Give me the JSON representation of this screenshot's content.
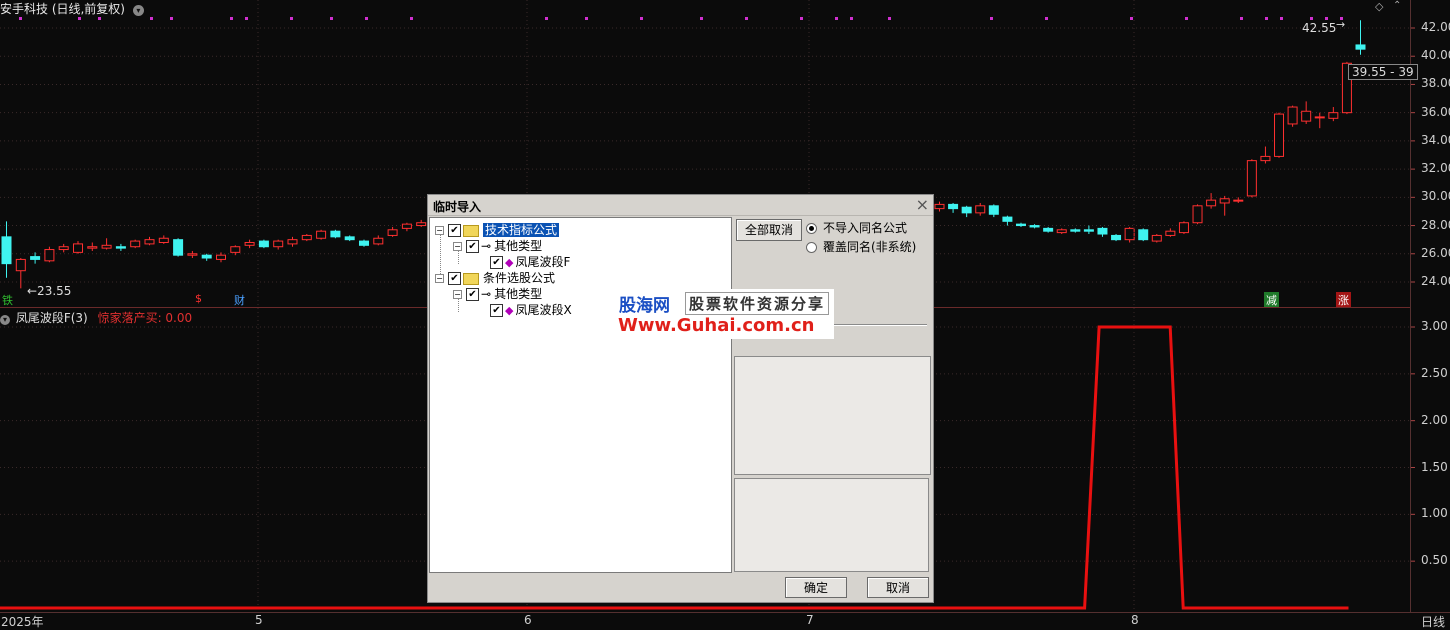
{
  "header": {
    "stock_title": "安手科技 (日线,前复权)",
    "indicator_title": "凤尾波段F(3)",
    "indicator_value": "惊家落产买: 0.00"
  },
  "colors": {
    "up": "#ff3030",
    "down": "#3ff3f0",
    "ma_dot": "#d030d0",
    "indicator_line": "#e81010",
    "grid": "#3a2a2a"
  },
  "price_axis": {
    "ticks": [
      "42.00",
      "40.00",
      "38.00",
      "36.00",
      "34.00",
      "32.00",
      "30.00",
      "28.00",
      "26.00",
      "24.00"
    ]
  },
  "indicator_axis": {
    "ticks": [
      "3.00",
      "2.50",
      "2.00",
      "1.50",
      "1.00",
      "0.50"
    ]
  },
  "time_axis": {
    "ticks": [
      "2025年",
      "5",
      "6",
      "7",
      "8"
    ],
    "period": "日线"
  },
  "price_labels": {
    "low": "←23.55",
    "high": "42.55",
    "range": "39.55 - 39"
  },
  "events": [
    {
      "text": "铁",
      "color": "#30c030"
    },
    {
      "text": "$",
      "color": "#ff3030"
    },
    {
      "text": "财",
      "color": "#4aa0ff"
    },
    {
      "text": "减",
      "color": "#2ecc40"
    },
    {
      "text": "涨",
      "color": "#ff3030"
    }
  ],
  "chart_data": [
    {
      "type": "candlestick",
      "title": "安手科技 (日线,前复权)",
      "ylim": [
        23,
        43
      ],
      "x": [
        "2025年",
        "5",
        "6",
        "7",
        "8"
      ],
      "candles": [
        {
          "o": 27.2,
          "c": 25.3,
          "h": 28.3,
          "l": 24.3
        },
        {
          "o": 24.8,
          "c": 25.6,
          "h": 25.7,
          "l": 23.55
        },
        {
          "o": 25.8,
          "c": 25.6,
          "h": 26.1,
          "l": 25.3
        },
        {
          "o": 25.5,
          "c": 26.3,
          "h": 26.5,
          "l": 25.4
        },
        {
          "o": 26.3,
          "c": 26.5,
          "h": 26.7,
          "l": 26.1
        },
        {
          "o": 26.1,
          "c": 26.7,
          "h": 26.9,
          "l": 26.0
        },
        {
          "o": 26.4,
          "c": 26.5,
          "h": 26.8,
          "l": 26.2
        },
        {
          "o": 26.4,
          "c": 26.6,
          "h": 27.1,
          "l": 26.3
        },
        {
          "o": 26.5,
          "c": 26.4,
          "h": 26.7,
          "l": 26.2
        },
        {
          "o": 26.5,
          "c": 26.9,
          "h": 27.0,
          "l": 26.4
        },
        {
          "o": 26.7,
          "c": 27.0,
          "h": 27.2,
          "l": 26.6
        },
        {
          "o": 26.8,
          "c": 27.1,
          "h": 27.3,
          "l": 26.7
        },
        {
          "o": 27.0,
          "c": 25.9,
          "h": 27.1,
          "l": 25.8
        },
        {
          "o": 25.9,
          "c": 26.0,
          "h": 26.2,
          "l": 25.7
        },
        {
          "o": 25.9,
          "c": 25.7,
          "h": 26.0,
          "l": 25.5
        },
        {
          "o": 25.6,
          "c": 25.9,
          "h": 26.1,
          "l": 25.4
        },
        {
          "o": 26.1,
          "c": 26.5,
          "h": 26.6,
          "l": 25.9
        },
        {
          "o": 26.6,
          "c": 26.8,
          "h": 27.0,
          "l": 26.4
        },
        {
          "o": 26.9,
          "c": 26.5,
          "h": 27.0,
          "l": 26.4
        },
        {
          "o": 26.5,
          "c": 26.9,
          "h": 27.0,
          "l": 26.3
        },
        {
          "o": 26.7,
          "c": 27.0,
          "h": 27.2,
          "l": 26.5
        },
        {
          "o": 27.0,
          "c": 27.3,
          "h": 27.4,
          "l": 26.9
        },
        {
          "o": 27.1,
          "c": 27.6,
          "h": 27.7,
          "l": 27.0
        },
        {
          "o": 27.6,
          "c": 27.2,
          "h": 27.7,
          "l": 27.1
        },
        {
          "o": 27.2,
          "c": 27.0,
          "h": 27.3,
          "l": 26.9
        },
        {
          "o": 26.9,
          "c": 26.6,
          "h": 27.0,
          "l": 26.5
        },
        {
          "o": 26.7,
          "c": 27.1,
          "h": 27.3,
          "l": 26.6
        },
        {
          "o": 27.3,
          "c": 27.7,
          "h": 27.9,
          "l": 27.2
        },
        {
          "o": 27.8,
          "c": 28.1,
          "h": 28.2,
          "l": 27.6
        },
        {
          "o": 28.0,
          "c": 28.2,
          "h": 28.4,
          "l": 27.9
        },
        {
          "o": 29.2,
          "c": 29.5,
          "h": 29.7,
          "l": 29.0
        },
        {
          "o": 29.5,
          "c": 29.2,
          "h": 29.6,
          "l": 28.9
        },
        {
          "o": 29.3,
          "c": 28.9,
          "h": 29.4,
          "l": 28.6
        },
        {
          "o": 28.9,
          "c": 29.4,
          "h": 29.6,
          "l": 28.7
        },
        {
          "o": 29.4,
          "c": 28.8,
          "h": 29.5,
          "l": 28.6
        },
        {
          "o": 28.6,
          "c": 28.3,
          "h": 28.7,
          "l": 28.0
        },
        {
          "o": 28.1,
          "c": 28.0,
          "h": 28.2,
          "l": 27.9
        },
        {
          "o": 28.0,
          "c": 27.9,
          "h": 28.1,
          "l": 27.8
        },
        {
          "o": 27.8,
          "c": 27.6,
          "h": 27.9,
          "l": 27.5
        },
        {
          "o": 27.5,
          "c": 27.7,
          "h": 27.8,
          "l": 27.4
        },
        {
          "o": 27.7,
          "c": 27.6,
          "h": 27.8,
          "l": 27.5
        },
        {
          "o": 27.7,
          "c": 27.6,
          "h": 28.0,
          "l": 27.4
        },
        {
          "o": 27.8,
          "c": 27.4,
          "h": 27.9,
          "l": 27.2
        },
        {
          "o": 27.3,
          "c": 27.0,
          "h": 27.4,
          "l": 26.9
        },
        {
          "o": 27.0,
          "c": 27.8,
          "h": 27.9,
          "l": 26.8
        },
        {
          "o": 27.7,
          "c": 27.0,
          "h": 27.8,
          "l": 26.9
        },
        {
          "o": 26.9,
          "c": 27.3,
          "h": 27.4,
          "l": 26.8
        },
        {
          "o": 27.3,
          "c": 27.6,
          "h": 27.8,
          "l": 27.2
        },
        {
          "o": 27.5,
          "c": 28.2,
          "h": 28.3,
          "l": 27.4
        },
        {
          "o": 28.2,
          "c": 29.4,
          "h": 29.5,
          "l": 28.1
        },
        {
          "o": 29.4,
          "c": 29.8,
          "h": 30.3,
          "l": 29.2
        },
        {
          "o": 29.6,
          "c": 29.9,
          "h": 30.1,
          "l": 28.7
        },
        {
          "o": 29.8,
          "c": 29.8,
          "h": 30.0,
          "l": 29.6
        },
        {
          "o": 30.1,
          "c": 32.6,
          "h": 32.7,
          "l": 30.0
        },
        {
          "o": 32.6,
          "c": 32.9,
          "h": 33.6,
          "l": 32.4
        },
        {
          "o": 32.9,
          "c": 35.9,
          "h": 36.0,
          "l": 32.8
        },
        {
          "o": 35.2,
          "c": 36.4,
          "h": 36.5,
          "l": 35.0
        },
        {
          "o": 35.4,
          "c": 36.1,
          "h": 36.8,
          "l": 35.2
        },
        {
          "o": 35.7,
          "c": 35.7,
          "h": 36.0,
          "l": 34.9
        },
        {
          "o": 35.6,
          "c": 36.0,
          "h": 36.4,
          "l": 35.4
        },
        {
          "o": 36.0,
          "c": 39.5,
          "h": 39.6,
          "l": 35.9
        },
        {
          "o": 40.8,
          "c": 40.5,
          "h": 42.55,
          "l": 40.1
        }
      ],
      "ytick_labels": [
        "42.00",
        "40.00",
        "38.00",
        "36.00",
        "34.00",
        "32.00",
        "30.00",
        "28.00",
        "26.00",
        "24.00"
      ]
    },
    {
      "type": "line",
      "title": "凤尾波段F(3)",
      "ylim": [
        0,
        3.2
      ],
      "series": [
        {
          "values_x_fraction": [
            0.0,
            0.748,
            0.758,
            0.807,
            0.816,
            0.93
          ],
          "values": [
            0,
            0,
            3,
            3,
            0,
            0
          ]
        }
      ],
      "ytick_labels": [
        "3.00",
        "2.50",
        "2.00",
        "1.50",
        "1.00",
        "0.50"
      ]
    }
  ],
  "dialog": {
    "title": "临时导入",
    "close_glyph": "×",
    "tree": [
      {
        "level": 0,
        "kind": "folder",
        "label": "技术指标公式",
        "selected": true,
        "checked": true
      },
      {
        "level": 1,
        "kind": "key",
        "label": "其他类型",
        "checked": true
      },
      {
        "level": 2,
        "kind": "gem",
        "label": "凤尾波段F",
        "checked": true
      },
      {
        "level": 0,
        "kind": "folder",
        "label": "条件选股公式",
        "checked": true
      },
      {
        "level": 1,
        "kind": "key",
        "label": "其他类型",
        "checked": true
      },
      {
        "level": 2,
        "kind": "gem",
        "label": "凤尾波段X",
        "checked": true
      }
    ],
    "cancel_all_label": "全部取消",
    "radio_options": [
      {
        "label": "不导入同名公式",
        "selected": true
      },
      {
        "label": "覆盖同名(非系统)",
        "selected": false
      }
    ],
    "ok_label": "确定",
    "cancel_label": "取消"
  },
  "watermark": {
    "brand": "股海网",
    "slogan": "股票软件资源分享",
    "url": "Www.Guhai.com.cn"
  }
}
